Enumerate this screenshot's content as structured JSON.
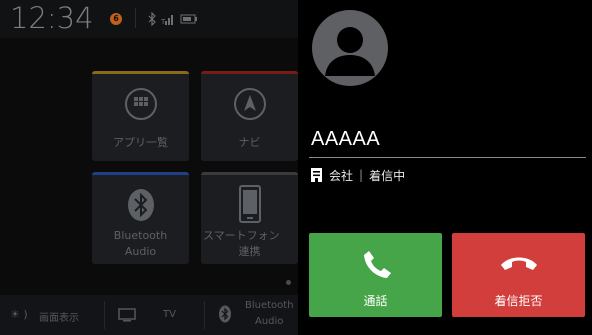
{
  "status_bar": {
    "time": "12:34",
    "notification_count": "6"
  },
  "home": {
    "tiles": [
      {
        "label": "アプリ一覧",
        "icon": "app-grid-icon",
        "accent": "#b8860b"
      },
      {
        "label": "ナビ",
        "icon": "navigation-arrow-icon",
        "accent": "#b3261e"
      },
      {
        "label_line1": "Bluetooth",
        "label_line2": "Audio",
        "icon": "bluetooth-icon",
        "accent": "#2b59c3"
      },
      {
        "label_line1": "スマートフォン",
        "label_line2": "連携",
        "icon": "smartphone-icon",
        "accent": "#555555"
      }
    ],
    "bottom_bar": {
      "display_label": "画面表示",
      "tv_label": "TV",
      "bt_line1": "Bluetooth",
      "bt_line2": "Audio"
    }
  },
  "call": {
    "caller_name": "AAAAA",
    "category": "会社",
    "status": "着信中",
    "answer_label": "通話",
    "decline_label": "着信拒否",
    "colors": {
      "answer": "#46a548",
      "decline": "#d23e3c"
    }
  }
}
